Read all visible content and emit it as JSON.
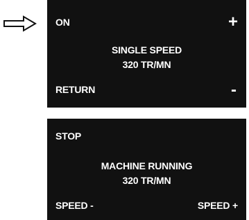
{
  "indicator": {
    "icon": "right-arrow-icon"
  },
  "panel_top": {
    "top_left": "ON",
    "top_right": "+",
    "mode_line": "SINGLE SPEED",
    "speed_line": "320 TR/MN",
    "bottom_left": "RETURN",
    "bottom_right": "-"
  },
  "panel_bottom": {
    "top_left": "STOP",
    "status_line": "MACHINE RUNNING",
    "speed_line": "320 TR/MN",
    "bottom_left": "SPEED -",
    "bottom_right": "SPEED +"
  },
  "colors": {
    "panel_bg": "#111111",
    "panel_text": "#ffffff",
    "page_bg": "#ffffff"
  }
}
